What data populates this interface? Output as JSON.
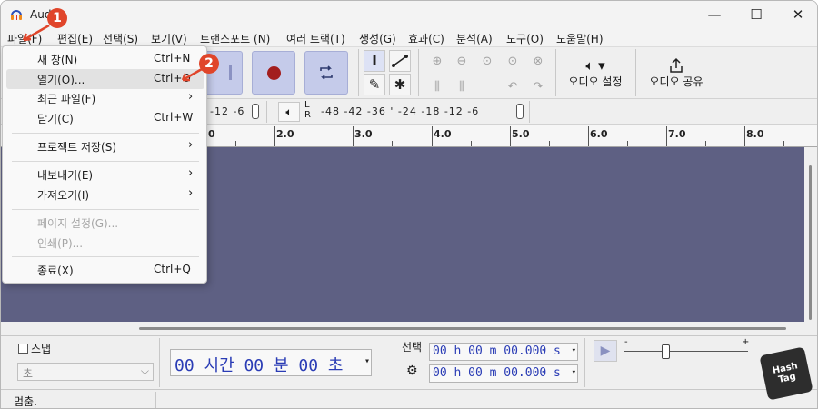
{
  "window": {
    "title": "Aud",
    "controls": {
      "minimize": "—",
      "maximize": "☐",
      "close": "✕"
    }
  },
  "menubar": {
    "items": [
      "파일(F)",
      "편집(E)",
      "선택(S)",
      "보기(V)",
      "트랜스포트 (N)",
      "여러 트랙(T)",
      "생성(G)",
      "효과(C)",
      "분석(A)",
      "도구(O)",
      "도움말(H)"
    ]
  },
  "toolbar": {
    "audio_settings_label": "오디오 설정",
    "audio_share_label": "오디오 공유"
  },
  "meters": {
    "playback_scale": "-12  -6",
    "record_lr": "L\nR",
    "record_scale": "-48 -42 -36   '   -24 -18 -12  -6"
  },
  "ruler": {
    "labels": [
      "0",
      "2.0",
      "3.0",
      "4.0",
      "5.0",
      "6.0",
      "7.0",
      "8.0"
    ]
  },
  "bottom": {
    "snap_label": "스냅",
    "snap_unit": "초",
    "time_display": "00 시간 00 분 00 초",
    "selection_label": "선택",
    "sel_start": "00 h 00 m 00.000 s",
    "sel_end": "00 h 00 m 00.000 s",
    "speed_min": "-",
    "speed_max": "+"
  },
  "status": {
    "text": "멈춤."
  },
  "file_menu": {
    "items": [
      {
        "label": "새 창(N)",
        "shortcut": "Ctrl+N",
        "submenu": false,
        "disabled": false
      },
      {
        "label": "열기(O)...",
        "shortcut": "Ctrl+O",
        "submenu": false,
        "disabled": false
      },
      {
        "label": "최근 파일(F)",
        "shortcut": "",
        "submenu": true,
        "disabled": false
      },
      {
        "label": "닫기(C)",
        "shortcut": "Ctrl+W",
        "submenu": false,
        "disabled": false
      },
      {
        "label": "프로젝트 저장(S)",
        "shortcut": "",
        "submenu": true,
        "disabled": false
      },
      {
        "label": "내보내기(E)",
        "shortcut": "",
        "submenu": true,
        "disabled": false
      },
      {
        "label": "가져오기(I)",
        "shortcut": "",
        "submenu": true,
        "disabled": false
      },
      {
        "label": "페이지 설정(G)...",
        "shortcut": "",
        "submenu": false,
        "disabled": true
      },
      {
        "label": "인쇄(P)...",
        "shortcut": "",
        "submenu": false,
        "disabled": true
      },
      {
        "label": "종료(X)",
        "shortcut": "Ctrl+Q",
        "submenu": false,
        "disabled": false
      }
    ]
  },
  "badges": {
    "one": "1",
    "two": "2"
  },
  "watermark": {
    "line1": "Hash",
    "line2": "Tag"
  },
  "colors": {
    "accent": "#c5cbea",
    "track_bg": "#5e6083",
    "badge": "#e0452a",
    "record": "#a31e1e",
    "time_text": "#2a3cb5"
  }
}
